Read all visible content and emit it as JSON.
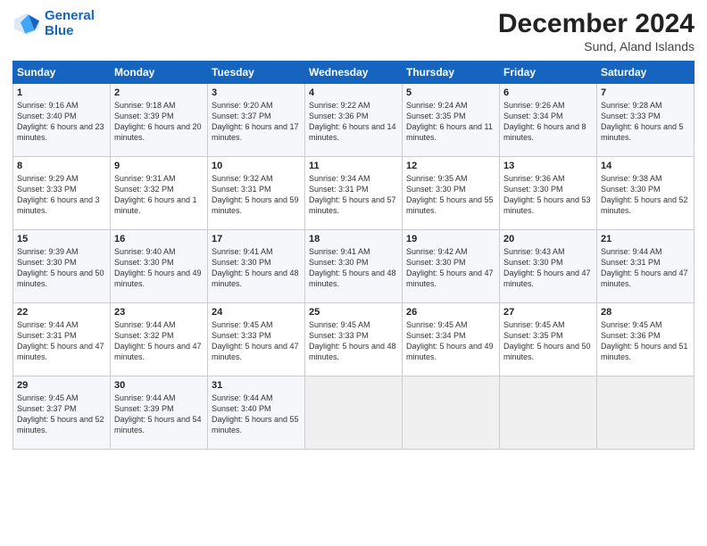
{
  "logo": {
    "line1": "General",
    "line2": "Blue"
  },
  "title": "December 2024",
  "subtitle": "Sund, Aland Islands",
  "days_header": [
    "Sunday",
    "Monday",
    "Tuesday",
    "Wednesday",
    "Thursday",
    "Friday",
    "Saturday"
  ],
  "weeks": [
    [
      {
        "day": "1",
        "sunrise": "9:16 AM",
        "sunset": "3:40 PM",
        "daylight": "6 hours and 23 minutes."
      },
      {
        "day": "2",
        "sunrise": "9:18 AM",
        "sunset": "3:39 PM",
        "daylight": "6 hours and 20 minutes."
      },
      {
        "day": "3",
        "sunrise": "9:20 AM",
        "sunset": "3:37 PM",
        "daylight": "6 hours and 17 minutes."
      },
      {
        "day": "4",
        "sunrise": "9:22 AM",
        "sunset": "3:36 PM",
        "daylight": "6 hours and 14 minutes."
      },
      {
        "day": "5",
        "sunrise": "9:24 AM",
        "sunset": "3:35 PM",
        "daylight": "6 hours and 11 minutes."
      },
      {
        "day": "6",
        "sunrise": "9:26 AM",
        "sunset": "3:34 PM",
        "daylight": "6 hours and 8 minutes."
      },
      {
        "day": "7",
        "sunrise": "9:28 AM",
        "sunset": "3:33 PM",
        "daylight": "6 hours and 5 minutes."
      }
    ],
    [
      {
        "day": "8",
        "sunrise": "9:29 AM",
        "sunset": "3:33 PM",
        "daylight": "6 hours and 3 minutes."
      },
      {
        "day": "9",
        "sunrise": "9:31 AM",
        "sunset": "3:32 PM",
        "daylight": "6 hours and 1 minute."
      },
      {
        "day": "10",
        "sunrise": "9:32 AM",
        "sunset": "3:31 PM",
        "daylight": "5 hours and 59 minutes."
      },
      {
        "day": "11",
        "sunrise": "9:34 AM",
        "sunset": "3:31 PM",
        "daylight": "5 hours and 57 minutes."
      },
      {
        "day": "12",
        "sunrise": "9:35 AM",
        "sunset": "3:30 PM",
        "daylight": "5 hours and 55 minutes."
      },
      {
        "day": "13",
        "sunrise": "9:36 AM",
        "sunset": "3:30 PM",
        "daylight": "5 hours and 53 minutes."
      },
      {
        "day": "14",
        "sunrise": "9:38 AM",
        "sunset": "3:30 PM",
        "daylight": "5 hours and 52 minutes."
      }
    ],
    [
      {
        "day": "15",
        "sunrise": "9:39 AM",
        "sunset": "3:30 PM",
        "daylight": "5 hours and 50 minutes."
      },
      {
        "day": "16",
        "sunrise": "9:40 AM",
        "sunset": "3:30 PM",
        "daylight": "5 hours and 49 minutes."
      },
      {
        "day": "17",
        "sunrise": "9:41 AM",
        "sunset": "3:30 PM",
        "daylight": "5 hours and 48 minutes."
      },
      {
        "day": "18",
        "sunrise": "9:41 AM",
        "sunset": "3:30 PM",
        "daylight": "5 hours and 48 minutes."
      },
      {
        "day": "19",
        "sunrise": "9:42 AM",
        "sunset": "3:30 PM",
        "daylight": "5 hours and 47 minutes."
      },
      {
        "day": "20",
        "sunrise": "9:43 AM",
        "sunset": "3:30 PM",
        "daylight": "5 hours and 47 minutes."
      },
      {
        "day": "21",
        "sunrise": "9:44 AM",
        "sunset": "3:31 PM",
        "daylight": "5 hours and 47 minutes."
      }
    ],
    [
      {
        "day": "22",
        "sunrise": "9:44 AM",
        "sunset": "3:31 PM",
        "daylight": "5 hours and 47 minutes."
      },
      {
        "day": "23",
        "sunrise": "9:44 AM",
        "sunset": "3:32 PM",
        "daylight": "5 hours and 47 minutes."
      },
      {
        "day": "24",
        "sunrise": "9:45 AM",
        "sunset": "3:33 PM",
        "daylight": "5 hours and 47 minutes."
      },
      {
        "day": "25",
        "sunrise": "9:45 AM",
        "sunset": "3:33 PM",
        "daylight": "5 hours and 48 minutes."
      },
      {
        "day": "26",
        "sunrise": "9:45 AM",
        "sunset": "3:34 PM",
        "daylight": "5 hours and 49 minutes."
      },
      {
        "day": "27",
        "sunrise": "9:45 AM",
        "sunset": "3:35 PM",
        "daylight": "5 hours and 50 minutes."
      },
      {
        "day": "28",
        "sunrise": "9:45 AM",
        "sunset": "3:36 PM",
        "daylight": "5 hours and 51 minutes."
      }
    ],
    [
      {
        "day": "29",
        "sunrise": "9:45 AM",
        "sunset": "3:37 PM",
        "daylight": "5 hours and 52 minutes."
      },
      {
        "day": "30",
        "sunrise": "9:44 AM",
        "sunset": "3:39 PM",
        "daylight": "5 hours and 54 minutes."
      },
      {
        "day": "31",
        "sunrise": "9:44 AM",
        "sunset": "3:40 PM",
        "daylight": "5 hours and 55 minutes."
      },
      null,
      null,
      null,
      null
    ]
  ]
}
